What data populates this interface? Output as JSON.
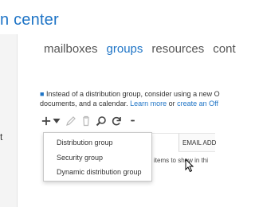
{
  "header": {
    "title": "n center"
  },
  "left_panel": {
    "partial_letter": "t"
  },
  "tabs": [
    {
      "label": "mailboxes",
      "active": false
    },
    {
      "label": "groups",
      "active": true
    },
    {
      "label": "resources",
      "active": false
    },
    {
      "label": "cont",
      "active": false
    }
  ],
  "info": {
    "line1": "Instead of a distribution group, consider using a new O",
    "line2_prefix": "documents, and a calendar. ",
    "learn_more": "Learn more",
    "or": " or ",
    "create_link": "create an Off"
  },
  "toolbar": {
    "icons": [
      "add-icon",
      "edit-icon",
      "delete-icon",
      "search-icon",
      "refresh-icon",
      "more-icon"
    ],
    "more_label": "•••"
  },
  "new_menu": {
    "items": [
      "Distribution group",
      "Security group",
      "Dynamic distribution group"
    ]
  },
  "grid": {
    "column_email": "EMAIL ADD",
    "empty_message": "items to show in thi"
  },
  "colors": {
    "accent": "#1e74c6",
    "text": "#333333",
    "disabled": "#b9b9b9"
  }
}
